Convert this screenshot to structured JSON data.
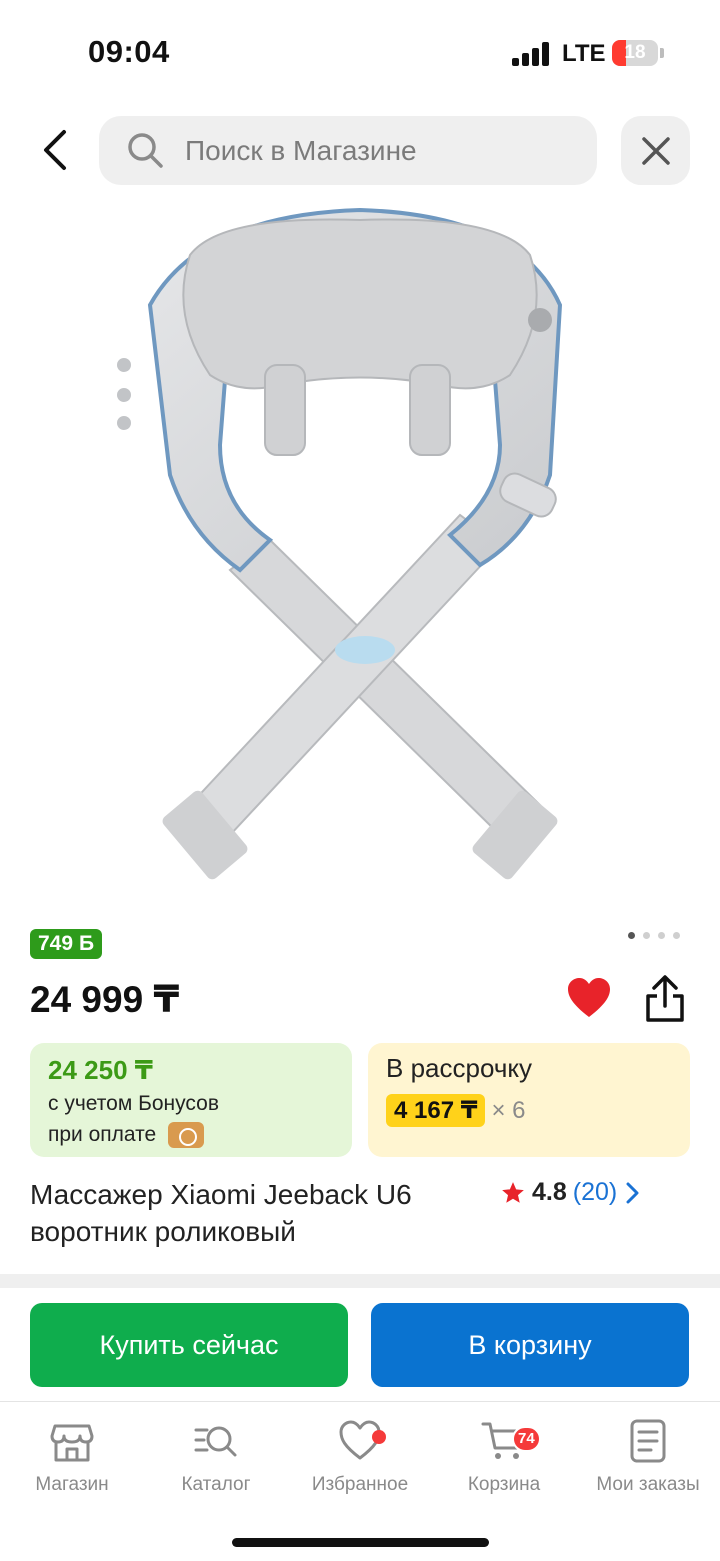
{
  "status_bar": {
    "time": "09:04",
    "network": "LTE",
    "battery": "18"
  },
  "search": {
    "placeholder": "Поиск в Магазине"
  },
  "product": {
    "bonus_badge": {
      "amount": "749",
      "currency": "Б"
    },
    "price": "24 999 ₸",
    "bonus_card": {
      "amount": "24 250 ₸",
      "line1": "с учетом Бонусов",
      "line2": "при оплате"
    },
    "installment_card": {
      "title": "В рассрочку",
      "monthly": "4 167 ₸",
      "multiplier": "× 6"
    },
    "title_line1": "Массажер Xiaomi Jeeback U6",
    "title_line2": "воротник роликовый",
    "rating": {
      "score": "4.8",
      "count": "(20)"
    },
    "gallery": {
      "total_images": 4,
      "current_index": 1
    },
    "favorite": true,
    "image_alt_icon": "neck-massager-image"
  },
  "actions": {
    "buy_now": "Купить сейчас",
    "add_to_cart": "В корзину"
  },
  "tabbar": {
    "items": [
      {
        "label": "Магазин",
        "icon": "store-icon"
      },
      {
        "label": "Каталог",
        "icon": "catalog-search-icon"
      },
      {
        "label": "Избранное",
        "icon": "heart-icon"
      },
      {
        "label": "Корзина",
        "icon": "cart-icon",
        "badge": "74"
      },
      {
        "label": "Мои заказы",
        "icon": "orders-icon"
      }
    ]
  },
  "colors": {
    "bonus_green": "#2e9b1b",
    "buy_green": "#0fad4d",
    "cart_blue": "#0a73d0",
    "installment_yellow": "#ffd21a",
    "heart_red": "#e8232a",
    "link_blue": "#1a72d4"
  }
}
